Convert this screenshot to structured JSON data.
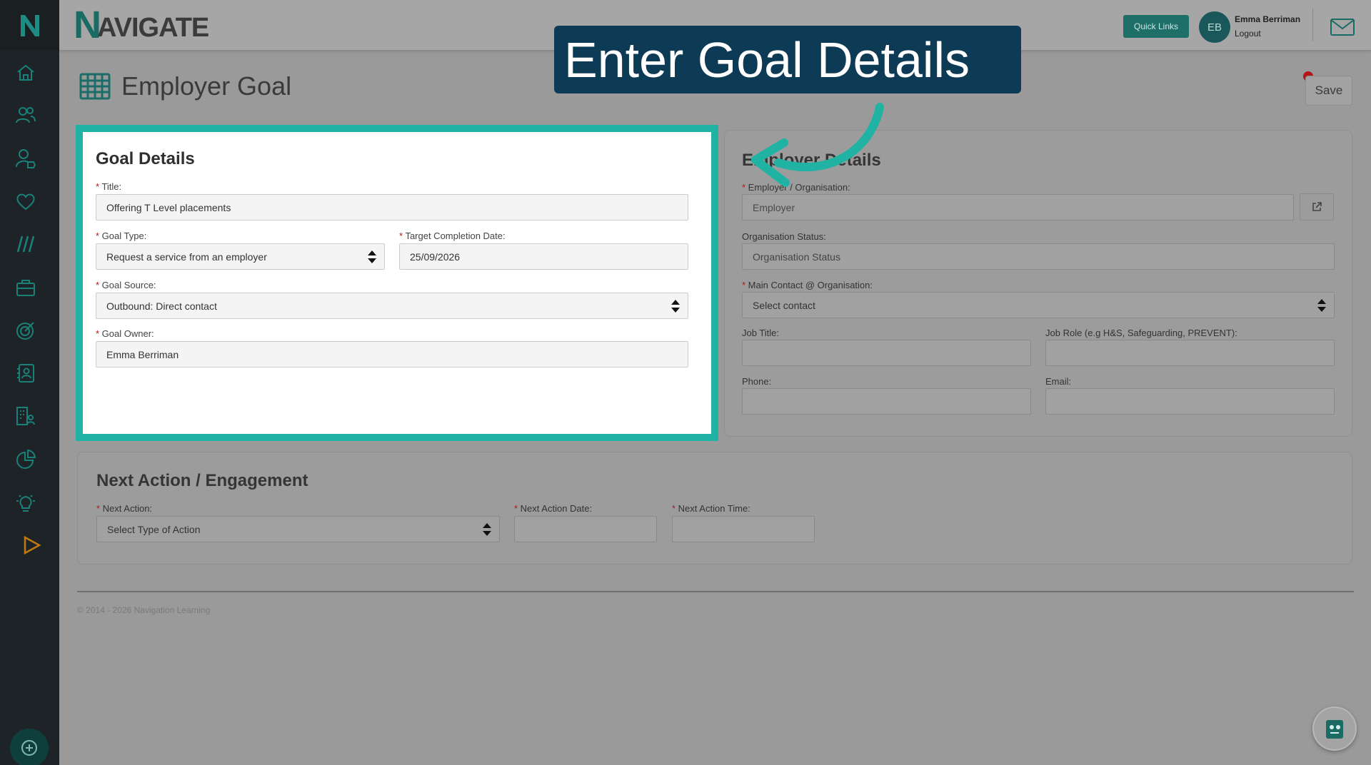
{
  "header": {
    "brand": "NAVIGATE",
    "quick_links": "Quick Links",
    "avatar_initials": "EB",
    "user_name": "Emma Berriman",
    "logout": "Logout"
  },
  "sidebar": {
    "items": [
      "home-icon",
      "users-icon",
      "user-tag-icon",
      "heart-icon",
      "slashes-icon",
      "briefcase-icon",
      "target-icon",
      "contact-book-icon",
      "building-users-icon",
      "pie-chart-icon",
      "lightbulb-icon",
      "play-icon"
    ]
  },
  "page": {
    "title": "Employer Goal",
    "save": "Save"
  },
  "callout": "Enter Goal Details",
  "goal_details": {
    "title": "Goal Details",
    "title_label": "Title:",
    "title_value": "Offering T Level placements",
    "goal_type_label": "Goal Type:",
    "goal_type_value": "Request a service from an employer",
    "target_date_label": "Target Completion Date:",
    "target_date_value": "25/09/2026",
    "goal_source_label": "Goal Source:",
    "goal_source_value": "Outbound: Direct contact",
    "goal_owner_label": "Goal Owner:",
    "goal_owner_value": "Emma Berriman"
  },
  "employer_details": {
    "title": "Employer Details",
    "employer_label": "Employer / Organisation:",
    "employer_placeholder": "Employer",
    "org_status_label": "Organisation Status:",
    "org_status_placeholder": "Organisation Status",
    "main_contact_label": "Main Contact @ Organisation:",
    "main_contact_value": "Select contact",
    "job_title_label": "Job Title:",
    "job_role_label": "Job Role (e.g H&S, Safeguarding, PREVENT):",
    "phone_label": "Phone:",
    "email_label": "Email:"
  },
  "next_action": {
    "title": "Next Action / Engagement",
    "action_label": "Next Action:",
    "action_value": "Select Type of Action",
    "date_label": "Next Action Date:",
    "time_label": "Next Action Time:"
  },
  "footer": {
    "copyright": "© 2014 - 2026 Navigation Learning"
  },
  "colors": {
    "accent": "#20b3a4",
    "callout_bg": "#0d3a55",
    "sidebar_bg": "#1e2327",
    "required": "#b01a1a"
  }
}
